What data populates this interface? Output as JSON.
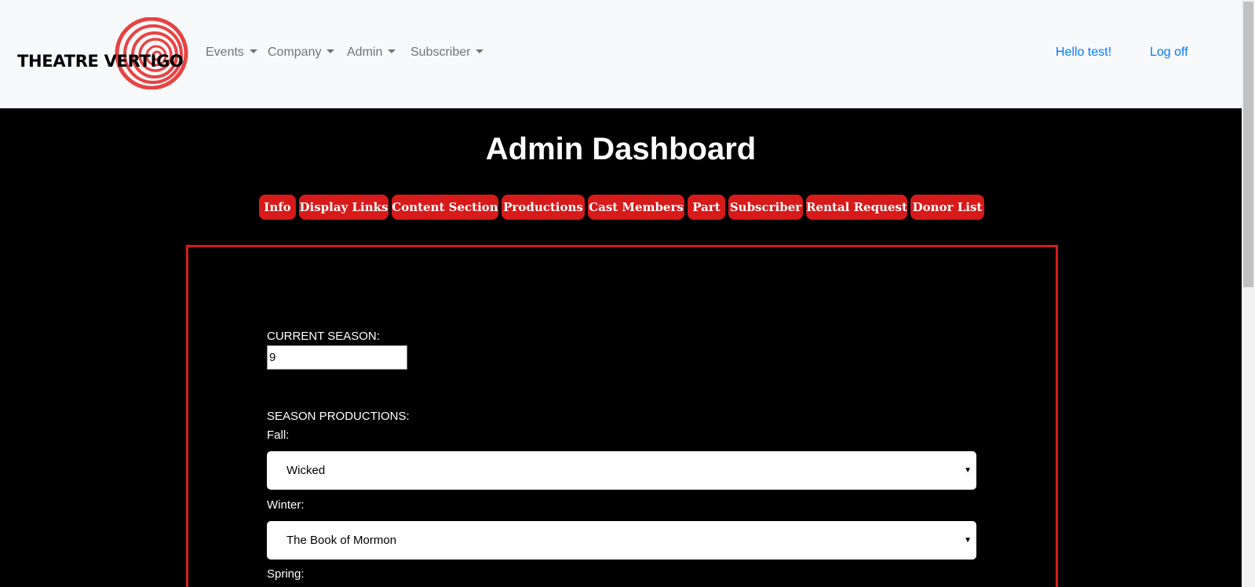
{
  "brand": {
    "name": "THEATRE VERTIGO"
  },
  "nav": {
    "items": [
      "Events",
      "Company",
      "Admin",
      "Subscriber"
    ],
    "greeting": "Hello test!",
    "logoff": "Log off"
  },
  "page": {
    "title": "Admin Dashboard"
  },
  "tabs": [
    "Info",
    "Display Links",
    "Content Section",
    "Productions",
    "Cast Members",
    "Part",
    "Subscriber",
    "Rental Request",
    "Donor List"
  ],
  "form": {
    "current_season_label": "CURRENT SEASON:",
    "current_season_value": "9",
    "season_productions_label": "SEASON PRODUCTIONS:",
    "fall_label": "Fall:",
    "fall_value": "Wicked",
    "winter_label": "Winter:",
    "winter_value": "The Book of Mormon",
    "spring_label": "Spring:",
    "select_arrow": "▼"
  },
  "colors": {
    "accent": "#d71a1a",
    "link": "#007bff",
    "nav_bg": "#f8f9fa"
  }
}
